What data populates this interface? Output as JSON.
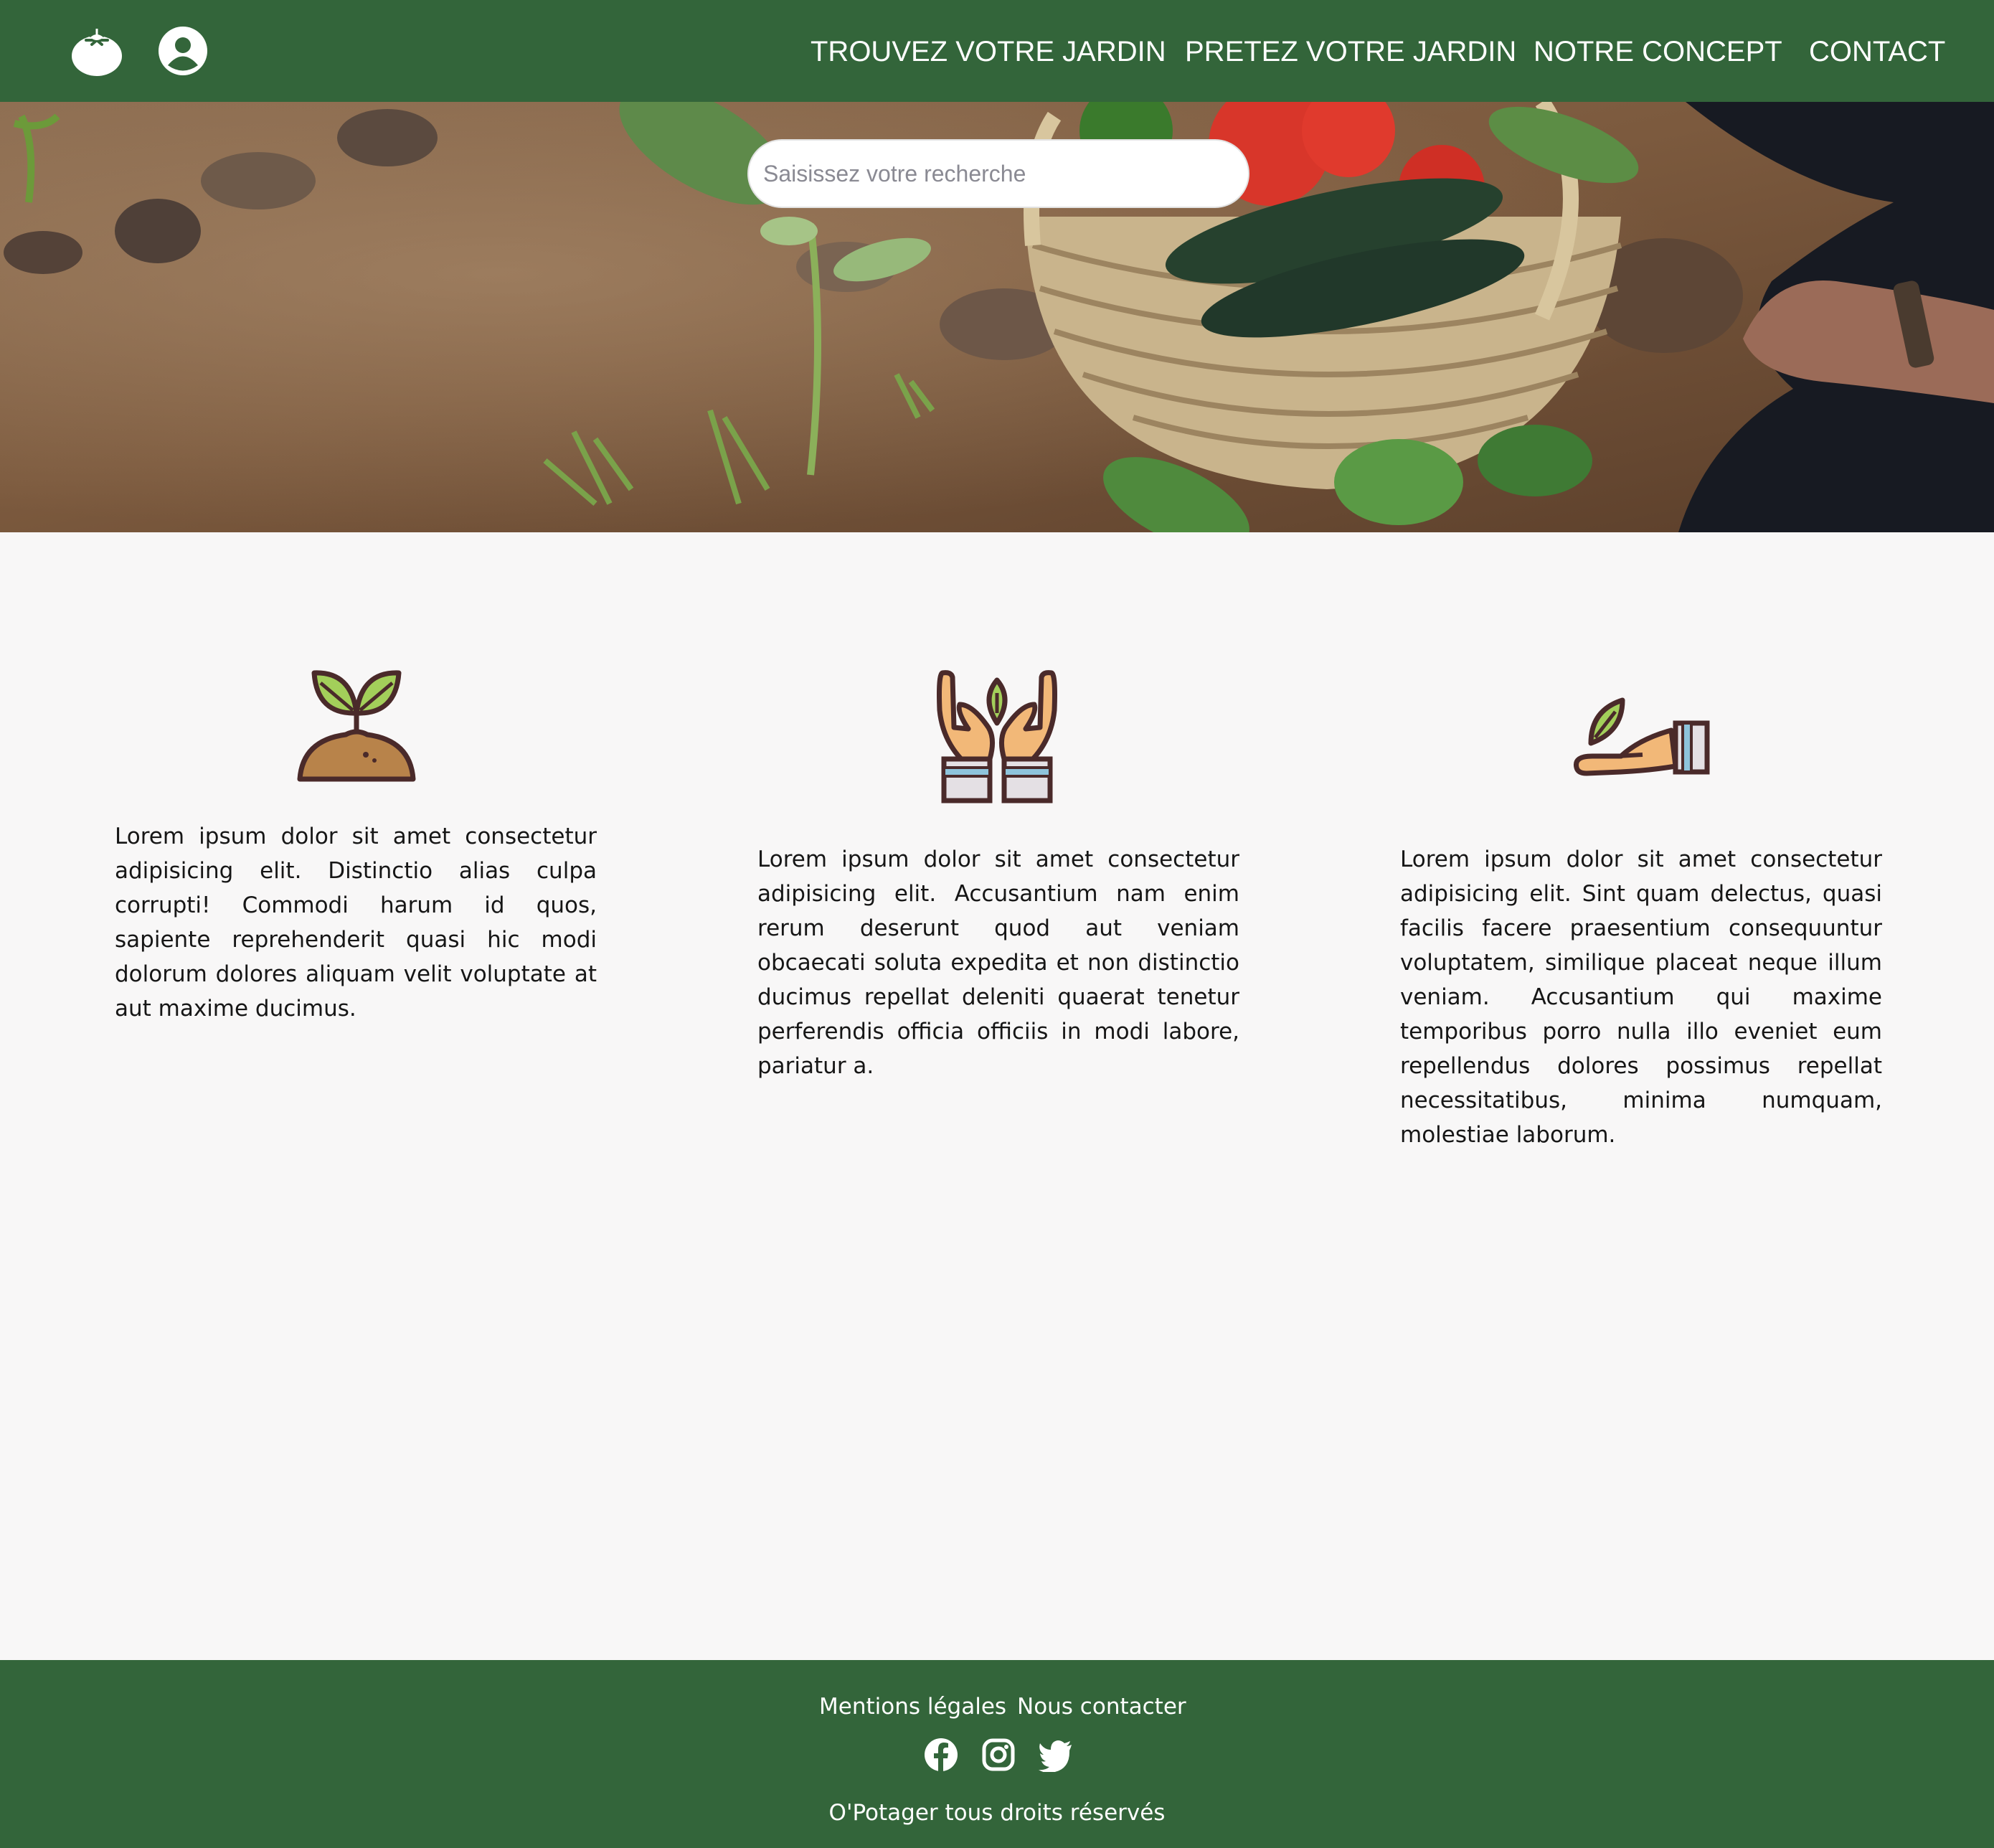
{
  "header": {
    "logo_icon": "tomato-icon",
    "account_icon": "user-circle-icon",
    "nav": [
      {
        "label": "TROUVEZ VOTRE JARDIN"
      },
      {
        "label": "PRETEZ VOTRE JARDIN"
      },
      {
        "label": "NOTRE CONCEPT"
      },
      {
        "label": "CONTACT"
      }
    ]
  },
  "hero": {
    "image": "garden-basket-photo",
    "search": {
      "placeholder": "Saisissez votre recherche",
      "value": ""
    }
  },
  "features": [
    {
      "icon": "sprout-icon",
      "text": "Lorem ipsum dolor sit amet consectetur adipisicing elit. Distinctio alias culpa corrupti! Commodi harum id quos, sapiente reprehenderit quasi hic modi dolorum dolores aliquam velit voluptate at aut maxime ducimus."
    },
    {
      "icon": "hands-leaf-icon",
      "text": "Lorem ipsum dolor sit amet consectetur adipisicing elit. Accusantium nam enim rerum deserunt quod aut veniam obcaecati soluta expedita et non distinctio ducimus repellat deleniti quaerat tenetur perferendis officia officiis in modi labore, pariatur a."
    },
    {
      "icon": "hand-leaf-icon",
      "text": "Lorem ipsum dolor sit amet consectetur adipisicing elit. Sint quam delectus, quasi facilis facere praesentium consequuntur voluptatem, similique placeat neque illum veniam. Accusantium qui maxime temporibus porro nulla illo eveniet eum repellendus dolores possimus repellat necessitatibus, minima numquam, molestiae laborum."
    }
  ],
  "footer": {
    "links": [
      {
        "label": "Mentions légales"
      },
      {
        "label": "Nous contacter"
      }
    ],
    "social_icons": [
      "facebook-icon",
      "instagram-icon",
      "twitter-icon"
    ],
    "copyright": "O'Potager tous droits réservés"
  },
  "colors": {
    "brand_green": "#33653a",
    "page_background": "#f8f7f7",
    "text": "#161616"
  }
}
